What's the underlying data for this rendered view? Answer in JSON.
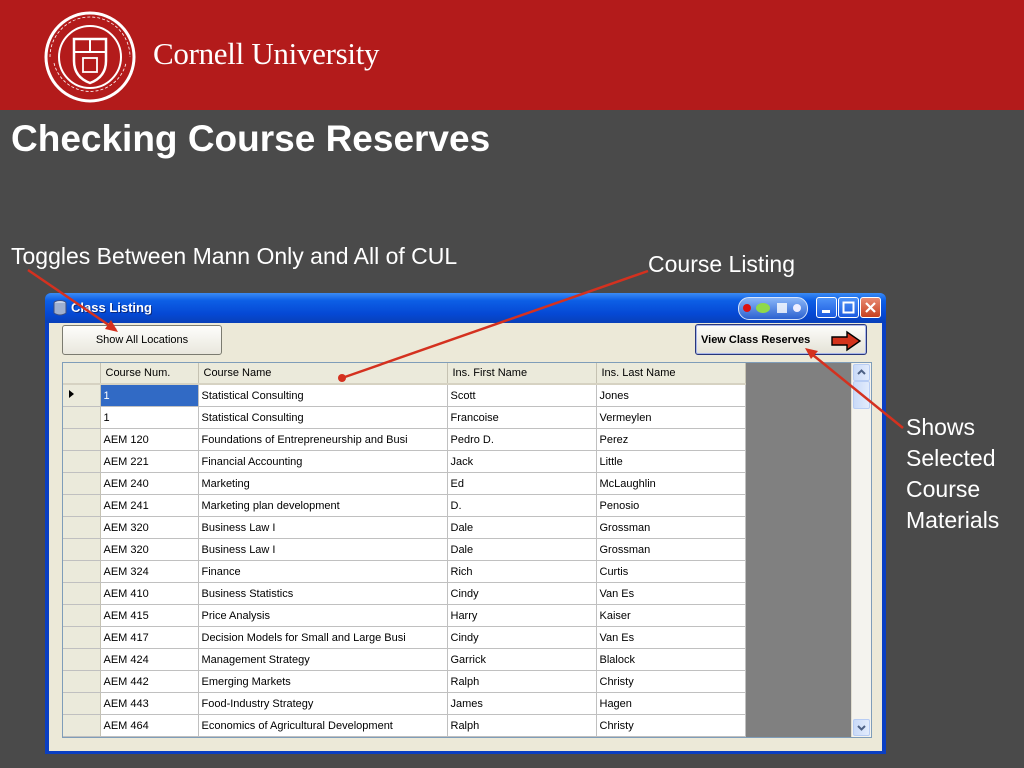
{
  "header": {
    "brand": "Cornell University"
  },
  "slide": {
    "title": "Checking Course Reserves",
    "annotations": {
      "toggle": "Toggles Between Mann Only and All of CUL",
      "listing": "Course Listing",
      "reserves": "Shows Selected Course Materials"
    }
  },
  "window": {
    "title": "Class Listing",
    "location_button": "Show All Locations",
    "reserves_button": "View Class Reserves"
  },
  "table": {
    "columns": [
      "Course Num.",
      "Course Name",
      "Ins. First Name",
      "Ins. Last Name"
    ],
    "rows": [
      [
        "1",
        "Statistical Consulting",
        "Scott",
        "Jones"
      ],
      [
        "1",
        "Statistical Consulting",
        "Francoise",
        "Vermeylen"
      ],
      [
        "AEM 120",
        "Foundations of Entrepreneurship and Busi",
        "Pedro D.",
        "Perez"
      ],
      [
        "AEM 221",
        "Financial Accounting",
        "Jack",
        "Little"
      ],
      [
        "AEM 240",
        "Marketing",
        "Ed",
        "McLaughlin"
      ],
      [
        "AEM 241",
        "Marketing plan development",
        "D.",
        "Penosio"
      ],
      [
        "AEM 320",
        "Business Law I",
        "Dale",
        "Grossman"
      ],
      [
        "AEM 320",
        "Business Law I",
        "Dale",
        "Grossman"
      ],
      [
        "AEM 324",
        "Finance",
        "Rich",
        "Curtis"
      ],
      [
        "AEM 410",
        "Business Statistics",
        "Cindy",
        "Van Es"
      ],
      [
        "AEM 415",
        "Price Analysis",
        "Harry",
        "Kaiser"
      ],
      [
        "AEM 417",
        "Decision Models for Small and Large Busi",
        "Cindy",
        "Van Es"
      ],
      [
        "AEM 424",
        "Management Strategy",
        "Garrick",
        "Blalock"
      ],
      [
        "AEM 442",
        "Emerging Markets",
        "Ralph",
        "Christy"
      ],
      [
        "AEM 443",
        "Food-Industry Strategy",
        "James",
        "Hagen"
      ],
      [
        "AEM 464",
        "Economics of Agricultural Development",
        "Ralph",
        "Christy"
      ]
    ]
  },
  "colors": {
    "banner": "#b31b1b",
    "background": "#4a4a4a",
    "annotation_arrow": "#d4311f",
    "selection": "#316ac5"
  },
  "icons": [
    "cornell-seal-icon",
    "app-icon",
    "minimize-icon",
    "maximize-icon",
    "close-icon",
    "arrow-right-icon",
    "scroll-up-icon",
    "scroll-down-icon",
    "row-pointer-icon"
  ]
}
